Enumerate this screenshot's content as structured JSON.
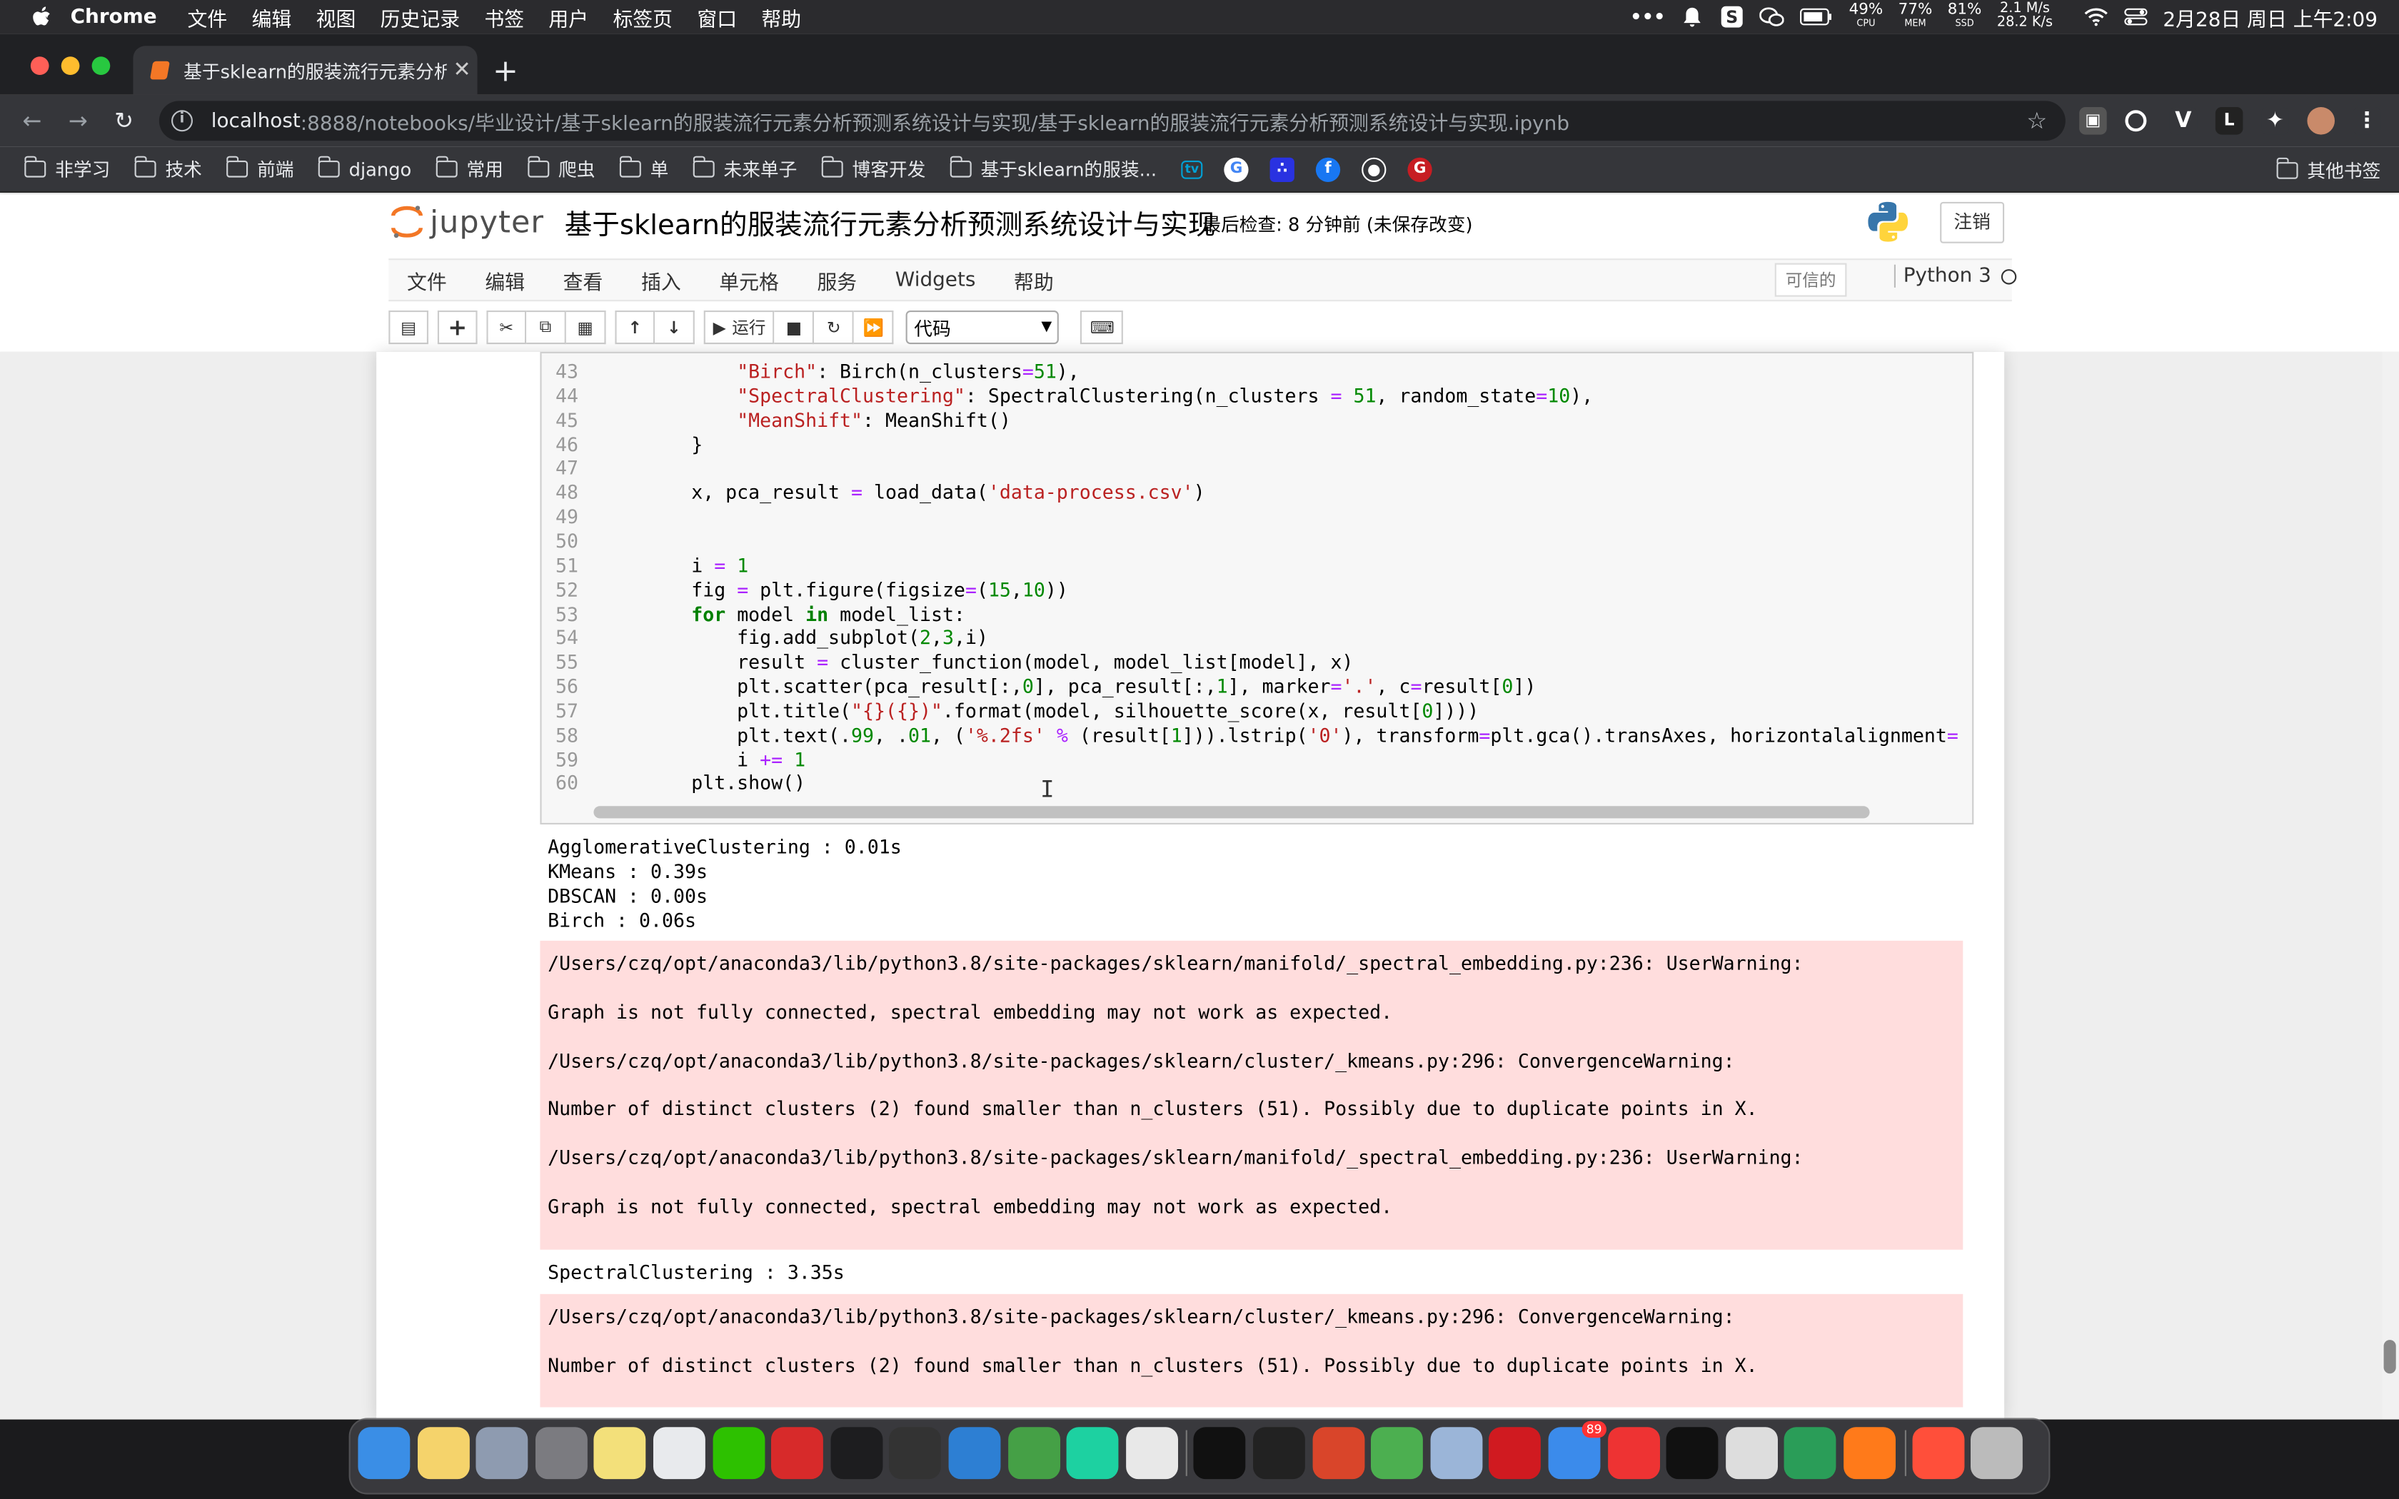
{
  "menubar": {
    "app": "Chrome",
    "items": [
      "文件",
      "编辑",
      "视图",
      "历史记录",
      "书签",
      "用户",
      "标签页",
      "窗口",
      "帮助"
    ],
    "status": {
      "cpu": "49%",
      "cpu_label": "CPU",
      "mem": "77%",
      "mem_label": "MEM",
      "ssd": "81%",
      "ssd_label": "SSD",
      "net_up": "2.1 M/s",
      "net_down": "28.2 K/s",
      "datetime": "2月28日 周日 上午2:09"
    }
  },
  "browser": {
    "tab_title": "基于sklearn的服装流行元素分析",
    "url_host": "localhost",
    "url_rest": ":8888/notebooks/毕业设计/基于sklearn的服装流行元素分析预测系统设计与实现/基于sklearn的服装流行元素分析预测系统设计与实现.ipynb",
    "bookmarks": [
      "非学习",
      "技术",
      "前端",
      "django",
      "常用",
      "爬虫",
      "单",
      "未来单子",
      "博客开发",
      "基于sklearn的服装..."
    ],
    "bookmarks_right": "其他书签"
  },
  "jupyter": {
    "logo": "jupyter",
    "title": "基于sklearn的服装流行元素分析预测系统设计与实现",
    "checkpoint": "最后检查: 8 分钟前",
    "unsaved": "(未保存改变)",
    "logout": "注销",
    "menu": [
      "文件",
      "编辑",
      "查看",
      "插入",
      "单元格",
      "服务",
      "Widgets",
      "帮助"
    ],
    "trusted": "可信的",
    "kernel": "Python 3",
    "run_label": "运行",
    "cell_type": "代码"
  },
  "code_lines": [
    {
      "n": "43",
      "t": "        \"Birch\": Birch(n_clusters=51),"
    },
    {
      "n": "44",
      "t": "        \"SpectralClustering\": SpectralClustering(n_clusters = 51, random_state=10),"
    },
    {
      "n": "45",
      "t": "        \"MeanShift\": MeanShift()"
    },
    {
      "n": "46",
      "t": "    }"
    },
    {
      "n": "47",
      "t": ""
    },
    {
      "n": "48",
      "t": "    x, pca_result = load_data('data-process.csv')"
    },
    {
      "n": "49",
      "t": ""
    },
    {
      "n": "50",
      "t": ""
    },
    {
      "n": "51",
      "t": "    i = 1"
    },
    {
      "n": "52",
      "t": "    fig = plt.figure(figsize=(15,10))"
    },
    {
      "n": "53",
      "t": "    for model in model_list:"
    },
    {
      "n": "54",
      "t": "        fig.add_subplot(2,3,i)"
    },
    {
      "n": "55",
      "t": "        result = cluster_function(model, model_list[model], x)"
    },
    {
      "n": "56",
      "t": "        plt.scatter(pca_result[:,0], pca_result[:,1], marker='.', c=result[0])"
    },
    {
      "n": "57",
      "t": "        plt.title(\"{}({})\".format(model, silhouette_score(x, result[0])))"
    },
    {
      "n": "58",
      "t": "        plt.text(.99, .01, ('%.2fs' % (result[1])).lstrip('0'), transform=plt.gca().transAxes, horizontalalignment="
    },
    {
      "n": "59",
      "t": "        i += 1"
    },
    {
      "n": "60",
      "t": "    plt.show()"
    }
  ],
  "outputs": {
    "stdout1": [
      "AgglomerativeClustering : 0.01s",
      "KMeans : 0.39s",
      "DBSCAN : 0.00s",
      "Birch : 0.06s"
    ],
    "stderr1": [
      "/Users/czq/opt/anaconda3/lib/python3.8/site-packages/sklearn/manifold/_spectral_embedding.py:236: UserWarning:",
      "Graph is not fully connected, spectral embedding may not work as expected.",
      "/Users/czq/opt/anaconda3/lib/python3.8/site-packages/sklearn/cluster/_kmeans.py:296: ConvergenceWarning:",
      "Number of distinct clusters (2) found smaller than n_clusters (51). Possibly due to duplicate points in X.",
      "/Users/czq/opt/anaconda3/lib/python3.8/site-packages/sklearn/manifold/_spectral_embedding.py:236: UserWarning:",
      "Graph is not fully connected, spectral embedding may not work as expected."
    ],
    "stdout2": [
      "SpectralClustering : 3.35s"
    ],
    "stderr2": [
      "/Users/czq/opt/anaconda3/lib/python3.8/site-packages/sklearn/cluster/_kmeans.py:296: ConvergenceWarning:",
      "Number of distinct clusters (2) found smaller than n_clusters (51). Possibly due to duplicate points in X."
    ]
  },
  "dock": {
    "badge_mail": "89",
    "apps": [
      "finder-icon",
      "notes-icon",
      "launchpad-icon",
      "system-prefs-icon",
      "stickies-icon",
      "chrome-icon",
      "wechat-icon",
      "wps-icon",
      "qq-icon",
      "et-icon",
      "vscode-icon",
      "anaconda-icon",
      "pycharm-icon",
      "typora-icon",
      "terminal-icon",
      "iterm-icon",
      "keynote-icon",
      "music-icon",
      "preview-icon",
      "youdao-icon",
      "mail-icon",
      "pdf-icon",
      "qq2-icon",
      "textedit-icon",
      "recycle-icon",
      "firefox-icon",
      "firefox2-icon",
      "trash-icon"
    ]
  }
}
